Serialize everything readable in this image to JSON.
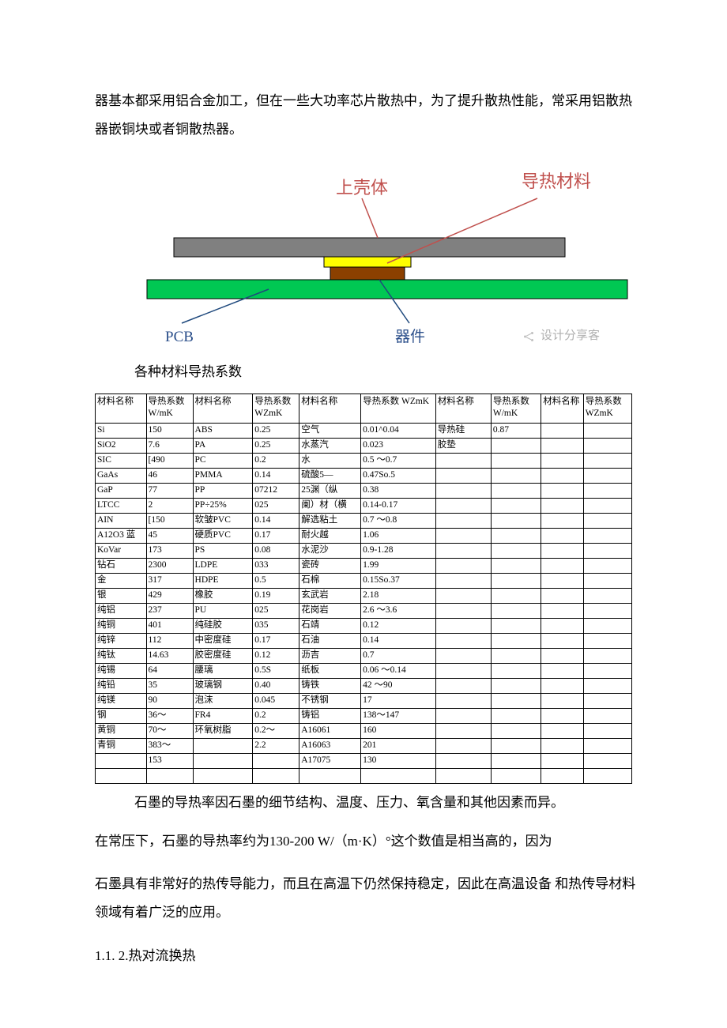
{
  "intro_para": "器基本都采用铝合金加工，但在一些大功率芯片散热中，为了提升散热性能，常采用铝散热器嵌铜块或者铜散热器。",
  "diagram": {
    "top_left": "上壳体",
    "top_right": "导热材料",
    "bottom_left": "PCB",
    "bottom_right": "器件",
    "share_badge": "设计分享客"
  },
  "caption": "各种材料导热系数",
  "headers": {
    "c1": "材料名称",
    "c2": "导热系数 W/mK",
    "c3": "材料名称",
    "c4": "导热系数 WZmK",
    "c5": "材料名称",
    "c6": "导热系数 WZmK",
    "c7": "材料名称",
    "c8": "导热系数 W/mK",
    "c9": "材料名称",
    "c10": "导热系数 WZmK"
  },
  "rows": [
    [
      "Si",
      "150",
      "ABS",
      "0.25",
      "空气",
      "0.01^0.04",
      "导热硅",
      "0.87",
      "",
      ""
    ],
    [
      "SiO2",
      "7.6",
      "PA",
      "0.25",
      "水蒸汽",
      "0.023",
      "胶垫",
      "",
      "",
      ""
    ],
    [
      "SIC",
      "[490",
      "PC",
      "0.2",
      "水",
      "0.5 ～0.7",
      "",
      "",
      "",
      ""
    ],
    [
      "GaAs",
      "46",
      "PMMA",
      "0.14",
      "硫酸5—",
      "0.47So.5",
      "",
      "",
      "",
      ""
    ],
    [
      "GaP",
      "77",
      "PP",
      "07212",
      "25渊（纵",
      "0.38",
      "",
      "",
      "",
      ""
    ],
    [
      "LTCC",
      "2",
      "PP÷25%",
      "025",
      "阑）材（横",
      "0.14-0.17",
      "",
      "",
      "",
      ""
    ],
    [
      "AIN",
      "[150",
      "软皱PVC",
      "0.14",
      "解选粘土",
      "0.7 ～0.8",
      "",
      "",
      "",
      ""
    ],
    [
      "A12O3 蓝",
      "45",
      "硬质PVC",
      "0.17",
      "耐火越",
      "1.06",
      "",
      "",
      "",
      ""
    ],
    [
      "KoVar",
      "173",
      "PS",
      "0.08",
      "水泥沙",
      "0.9-1.28",
      "",
      "",
      "",
      ""
    ],
    [
      "钻石",
      "2300",
      "LDPE",
      "033",
      "瓷砖",
      "1.99",
      "",
      "",
      "",
      ""
    ],
    [
      "金",
      "317",
      "HDPE",
      "0.5",
      "石棉",
      "0.15So.37",
      "",
      "",
      "",
      ""
    ],
    [
      "银",
      "429",
      "橡胶",
      "0.19",
      "玄武岩",
      "2.18",
      "",
      "",
      "",
      ""
    ],
    [
      "纯铝",
      "237",
      "PU",
      "025",
      "花岗岩",
      "2.6 ～3.6",
      "",
      "",
      "",
      ""
    ],
    [
      "纯铜",
      "401",
      "纯硅胶",
      "035",
      "石靖",
      "0.12",
      "",
      "",
      "",
      ""
    ],
    [
      "纯锌",
      "112",
      "中密度硅",
      "0.17",
      "石油",
      "0.14",
      "",
      "",
      "",
      ""
    ],
    [
      "纯钛",
      "14.63",
      "胶密度硅",
      "0.12",
      "沥吉",
      "0.7",
      "",
      "",
      "",
      ""
    ],
    [
      "纯锡",
      "64",
      "腰璃",
      "0.5S",
      "纸板",
      "0.06 ～0.14",
      "",
      "",
      "",
      ""
    ],
    [
      "纯铅",
      "35",
      "玻璃钢",
      "0.40",
      "铸铁",
      "42 ～90",
      "",
      "",
      "",
      ""
    ],
    [
      "纯镁",
      "90",
      "泡沫",
      "0.045",
      "不锈钢",
      "17",
      "",
      "",
      "",
      ""
    ],
    [
      "钢",
      "36～",
      "FR4",
      "0.2",
      "铸铝",
      "138～147",
      "",
      "",
      "",
      ""
    ],
    [
      "黄铜",
      "70～",
      "环氧树脂",
      "0.2～",
      "A16061",
      "160",
      "",
      "",
      "",
      ""
    ],
    [
      "青铜",
      "383～",
      "",
      "2.2",
      "A16063",
      "201",
      "",
      "",
      "",
      ""
    ],
    [
      "",
      "153",
      "",
      "",
      "A17075",
      "130",
      "",
      "",
      "",
      ""
    ],
    [
      "",
      "",
      "",
      "",
      "",
      "",
      "",
      "",
      "",
      ""
    ]
  ],
  "post_table_1": "石墨的导热率因石墨的细节结构、温度、压力、氧含量和其他因素而异。",
  "post_table_2": "在常压下，石墨的导热率约为130-200 W/（m·K）°这个数值是相当高的，因为",
  "post_table_3": "石墨具有非常好的热传导能力，而且在高温下仍然保持稳定，因此在高温设备 和热传导材料领域有着广泛的应用。",
  "section_head": "1.1. 2.热对流换热"
}
